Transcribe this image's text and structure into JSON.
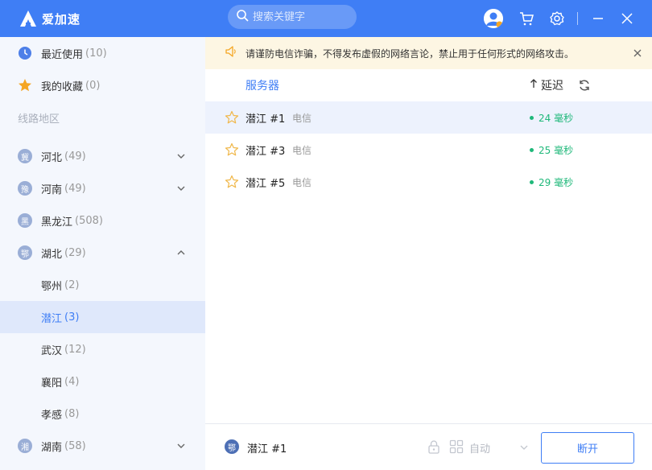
{
  "app": {
    "name": "爱加速"
  },
  "search": {
    "placeholder": "搜索关键字"
  },
  "sidebar": {
    "items": [
      {
        "label": "最近使用",
        "count": "(10)"
      },
      {
        "label": "我的收藏",
        "count": "(0)"
      },
      {
        "label": "线路地区"
      },
      {
        "badge": "冀",
        "label": "河北",
        "count": "(49)"
      },
      {
        "badge": "豫",
        "label": "河南",
        "count": "(49)"
      },
      {
        "badge": "黑",
        "label": "黑龙江",
        "count": "(508)"
      },
      {
        "badge": "鄂",
        "label": "湖北",
        "count": "(29)"
      },
      {
        "label": "鄂州",
        "count": "(2)"
      },
      {
        "label": "潜江",
        "count": "(3)"
      },
      {
        "label": "武汉",
        "count": "(12)"
      },
      {
        "label": "襄阳",
        "count": "(4)"
      },
      {
        "label": "孝感",
        "count": "(8)"
      },
      {
        "badge": "湘",
        "label": "湖南",
        "count": "(58)"
      }
    ]
  },
  "notice": {
    "text": "请谨防电信诈骗，不得发布虚假的网络言论，禁止用于任何形式的网络攻击。"
  },
  "list": {
    "header_server": "服务器",
    "header_latency": "延迟",
    "rows": [
      {
        "name": "潜江 #1",
        "isp": "电信",
        "ping": "24 毫秒"
      },
      {
        "name": "潜江 #3",
        "isp": "电信",
        "ping": "25 毫秒"
      },
      {
        "name": "潜江 #5",
        "isp": "电信",
        "ping": "29 毫秒"
      }
    ]
  },
  "bottom": {
    "badge": "鄂",
    "current": "潜江 #1",
    "mode": "自动",
    "disconnect": "断开"
  },
  "colors": {
    "accent": "#3f7ef5",
    "ping": "#1fb87a",
    "notice_bg": "#fdf6e3"
  }
}
